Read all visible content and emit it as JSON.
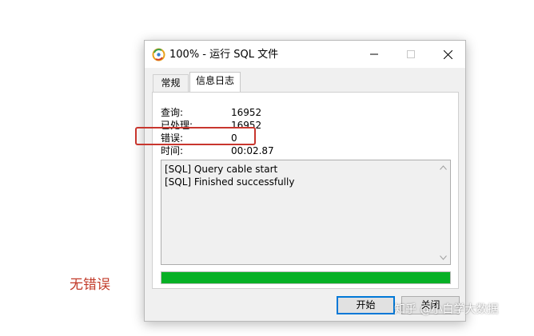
{
  "window": {
    "title": "100% - 运行 SQL 文件",
    "controls": {
      "minimize_icon": "minimize-icon",
      "maximize_icon": "maximize-icon",
      "close_icon": "close-icon"
    }
  },
  "tabs": [
    {
      "label": "常规",
      "active": false
    },
    {
      "label": "信息日志",
      "active": true
    }
  ],
  "stats": [
    {
      "label": "查询:",
      "value": "16952"
    },
    {
      "label": "已处理:",
      "value": "16952"
    },
    {
      "label": "错误:",
      "value": "0"
    },
    {
      "label": "时间:",
      "value": "00:02.87"
    }
  ],
  "log": {
    "lines": [
      "[SQL] Query cable start",
      "[SQL] Finished successfully"
    ]
  },
  "progress": {
    "fraction": 1.0,
    "color": "#06b025"
  },
  "buttons": {
    "start": "开始",
    "close": "关闭"
  },
  "annotation": {
    "text": "无错误",
    "color": "#c23b2a"
  },
  "watermark": "知乎 @小白学大数据"
}
